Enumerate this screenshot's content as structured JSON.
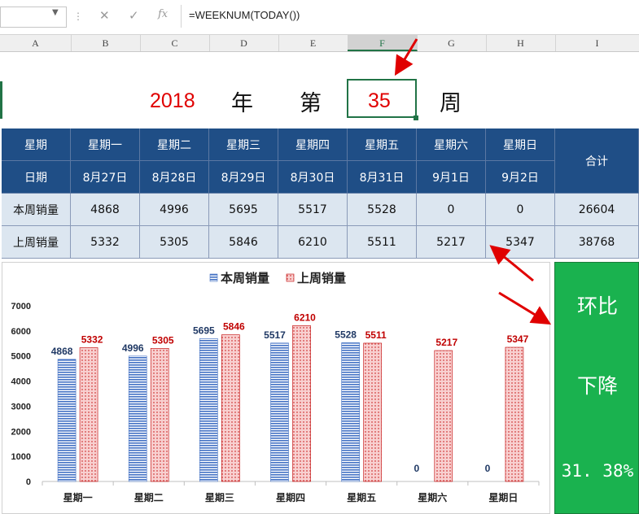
{
  "formula_bar": {
    "cancel_icon": "✕",
    "enter_icon": "✓",
    "fx_icon": "fx",
    "formula": "=WEEKNUM(TODAY())"
  },
  "columns": [
    "A",
    "B",
    "C",
    "D",
    "E",
    "F",
    "G",
    "H",
    "I"
  ],
  "selected_column": "F",
  "title_row": {
    "year": "2018",
    "year_char": "年",
    "di_char": "第",
    "week_number": "35",
    "week_char": "周"
  },
  "table": {
    "row1_label": "星期",
    "row2_label": "日期",
    "weekdays": [
      "星期一",
      "星期二",
      "星期三",
      "星期四",
      "星期五",
      "星期六",
      "星期日"
    ],
    "dates": [
      "8月27日",
      "8月28日",
      "8月29日",
      "8月30日",
      "8月31日",
      "9月1日",
      "9月2日"
    ],
    "total_label": "合计",
    "this_week_label": "本周销量",
    "last_week_label": "上周销量",
    "this_week": [
      "4868",
      "4996",
      "5695",
      "5517",
      "5528",
      "0",
      "0"
    ],
    "this_week_total": "26604",
    "last_week": [
      "5332",
      "5305",
      "5846",
      "6210",
      "5511",
      "5217",
      "5347"
    ],
    "last_week_total": "38768"
  },
  "chart_data": {
    "type": "bar",
    "categories": [
      "星期一",
      "星期二",
      "星期三",
      "星期四",
      "星期五",
      "星期六",
      "星期日"
    ],
    "series": [
      {
        "name": "本周销量",
        "values": [
          4868,
          4996,
          5695,
          5517,
          5528,
          0,
          0
        ],
        "color": "#4472c4"
      },
      {
        "name": "上周销量",
        "values": [
          5332,
          5305,
          5846,
          6210,
          5511,
          5217,
          5347
        ],
        "color": "#c00000"
      }
    ],
    "ylim": [
      0,
      7000
    ],
    "yticks": [
      0,
      1000,
      2000,
      3000,
      4000,
      5000,
      6000,
      7000
    ],
    "legend": "top-center",
    "grid": false
  },
  "ratio": {
    "label1": "环比",
    "label2": "下降",
    "value": "31. 38%"
  },
  "colors": {
    "header_bg": "#1f4e86",
    "body_bg": "#dce6f0",
    "accent_red": "#e00000",
    "excel_green": "#217346",
    "ratio_green": "#1ab24f"
  }
}
